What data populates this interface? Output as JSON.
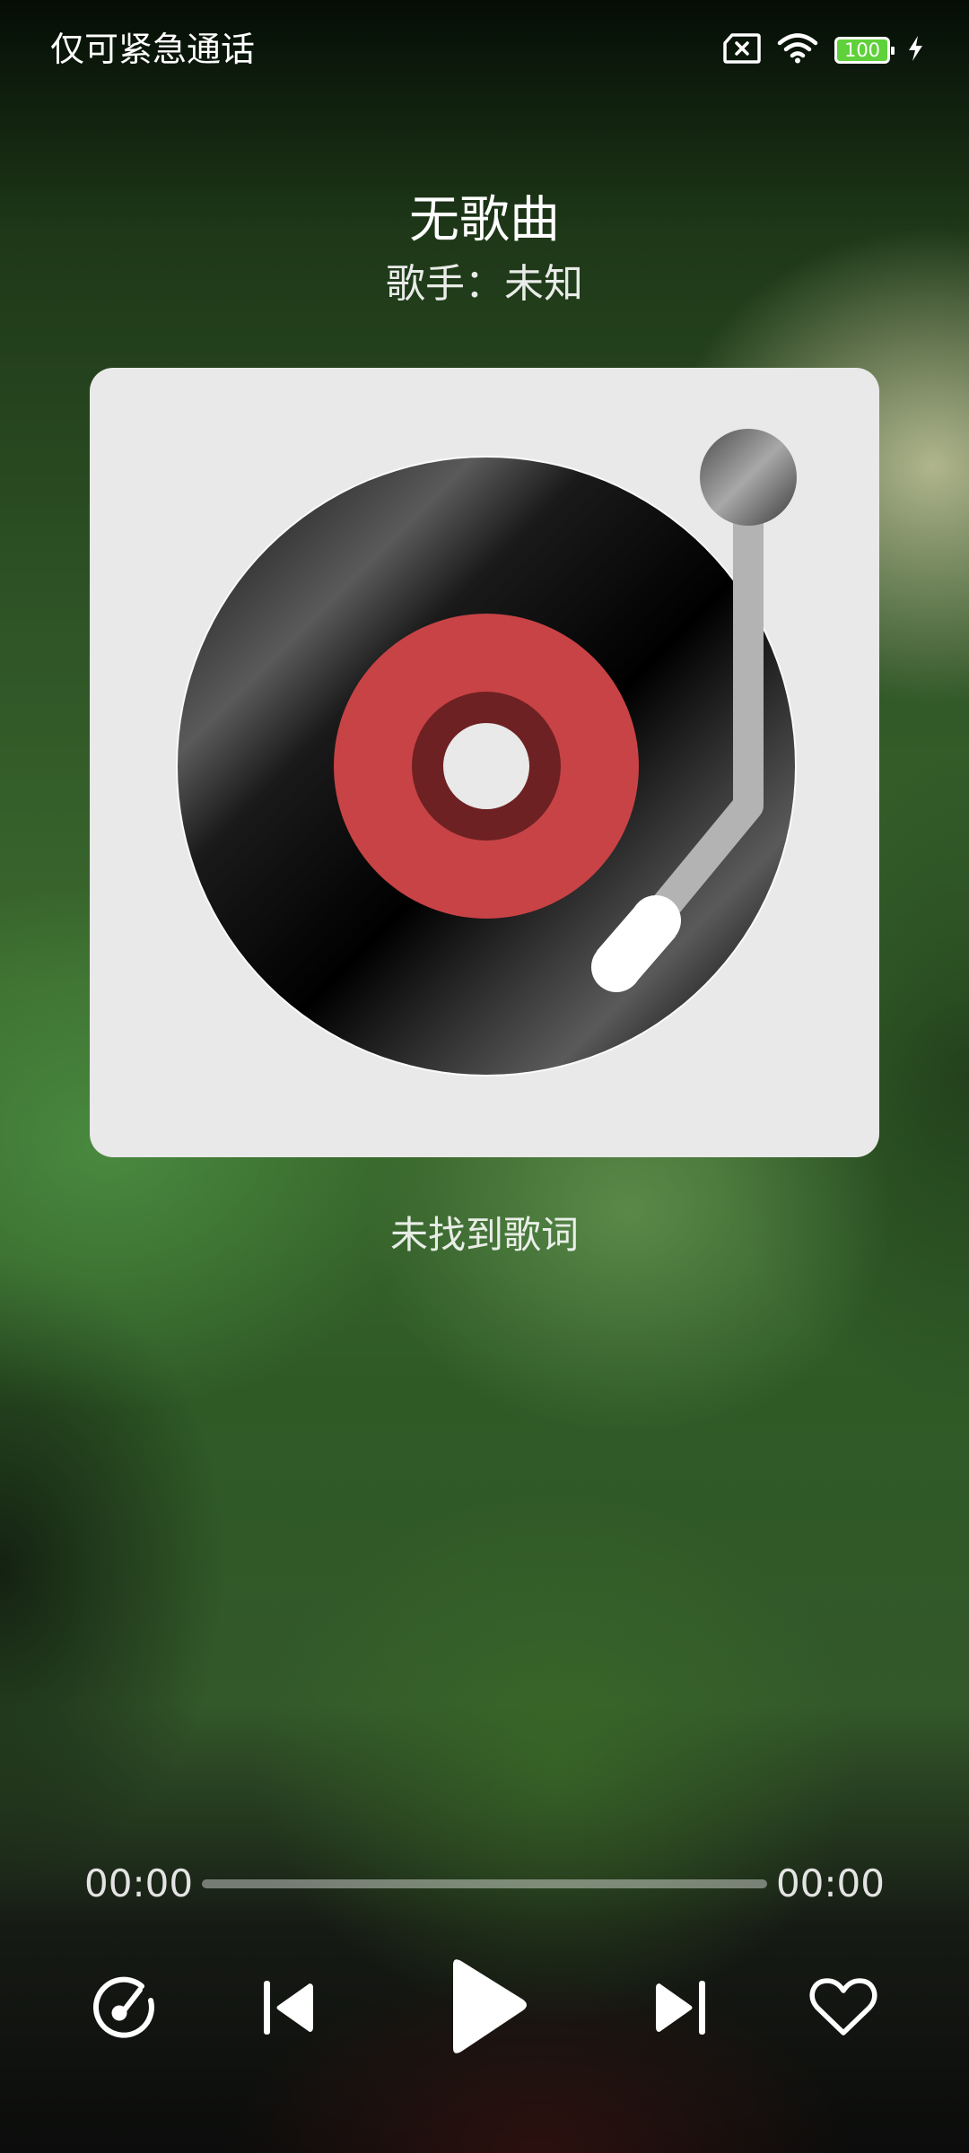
{
  "status_bar": {
    "carrier_text": "仅可紧急通话",
    "battery_level": "100",
    "icons": [
      "sim-card-none-icon",
      "wifi-icon",
      "battery-icon",
      "charging-bolt-icon"
    ]
  },
  "player": {
    "title": "无歌曲",
    "artist_line": "歌手：未知",
    "lyrics_status": "未找到歌词",
    "current_time": "00:00",
    "total_time": "00:00",
    "progress_fraction": 0
  },
  "controls": {
    "icons": [
      "play-mode-icon",
      "previous-track-icon",
      "play-icon",
      "next-track-icon",
      "favorite-heart-icon"
    ]
  },
  "colors": {
    "card_background": "#e9e9e9",
    "record_label": "#c84346",
    "label_inner_ring": "#6e2122",
    "tonearm": "#b3b3b3",
    "battery_fill": "#5fd13a"
  }
}
